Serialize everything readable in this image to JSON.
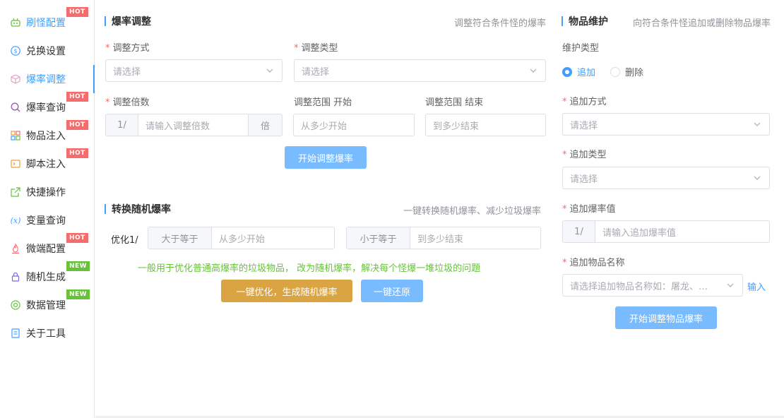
{
  "sidebar": {
    "items": [
      {
        "label": "刷怪配置",
        "icon": "robot-icon",
        "badge": "HOT"
      },
      {
        "label": "兑换设置",
        "icon": "coin-icon",
        "badge": ""
      },
      {
        "label": "爆率调整",
        "icon": "cube-icon",
        "badge": ""
      },
      {
        "label": "爆率查询",
        "icon": "search-icon",
        "badge": "HOT"
      },
      {
        "label": "物品注入",
        "icon": "grid-icon",
        "badge": "HOT"
      },
      {
        "label": "脚本注入",
        "icon": "terminal-icon",
        "badge": "HOT"
      },
      {
        "label": "快捷操作",
        "icon": "external-link-icon",
        "badge": ""
      },
      {
        "label": "变量查询",
        "icon": "variable-icon",
        "badge": ""
      },
      {
        "label": "微端配置",
        "icon": "flame-icon",
        "badge": "HOT"
      },
      {
        "label": "随机生成",
        "icon": "lock-icon",
        "badge": "NEW"
      },
      {
        "label": "数据管理",
        "icon": "database-icon",
        "badge": "NEW"
      },
      {
        "label": "关于工具",
        "icon": "document-icon",
        "badge": ""
      }
    ]
  },
  "rate_adjust": {
    "title": "爆率调整",
    "desc": "调整符合条件怪的爆率",
    "method_label": "调整方式",
    "method_placeholder": "请选择",
    "type_label": "调整类型",
    "type_placeholder": "请选择",
    "multiplier_label": "调整倍数",
    "multiplier_prefix": "1/",
    "multiplier_placeholder": "请输入调整倍数",
    "multiplier_suffix": "倍",
    "range_start_label": "调整范围 开始",
    "range_start_placeholder": "从多少开始",
    "range_end_label": "调整范围 结束",
    "range_end_placeholder": "到多少结束",
    "submit": "开始调整爆率"
  },
  "random_rate": {
    "title": "转换随机爆率",
    "desc": "一键转换随机爆率、减少垃圾爆率",
    "optimize_label": "优化1/",
    "gte_prefix": "大于等于",
    "gte_placeholder": "从多少开始",
    "lte_prefix": "小于等于",
    "lte_placeholder": "到多少结束",
    "note": "一般用于优化普通高爆率的垃圾物品， 改为随机爆率，解决每个怪爆一堆垃圾的问题",
    "optimize_button": "一键优化，生成随机爆率",
    "restore_button": "一键还原"
  },
  "item_maint": {
    "title": "物品维护",
    "desc": "向符合条件怪追加或删除物品爆率",
    "type_label": "维护类型",
    "radio_add": "追加",
    "radio_delete": "删除",
    "add_method_label": "追加方式",
    "add_method_placeholder": "请选择",
    "add_type_label": "追加类型",
    "add_type_placeholder": "请选择",
    "add_rate_label": "追加爆率值",
    "add_rate_prefix": "1/",
    "add_rate_placeholder": "请输入追加爆率值",
    "item_name_label": "追加物品名称",
    "item_name_placeholder": "请选择追加物品名称如：屠龙、…",
    "input_link": "输入",
    "submit": "开始调整物品爆率"
  }
}
